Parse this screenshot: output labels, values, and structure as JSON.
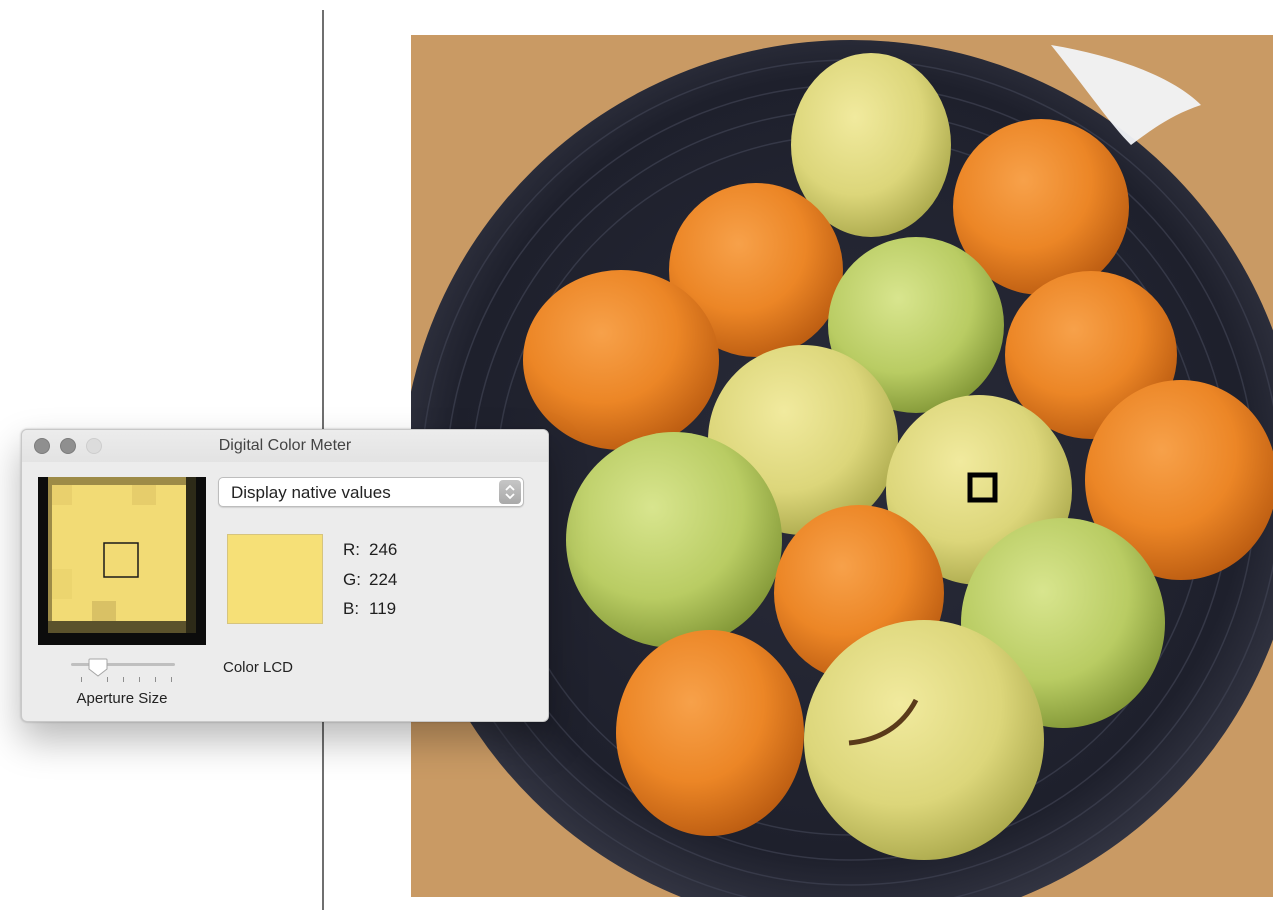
{
  "window": {
    "title": "Digital Color Meter"
  },
  "mode_select": {
    "value": "Display native values"
  },
  "color": {
    "r_label": "R:",
    "g_label": "G:",
    "b_label": "B:",
    "r": "246",
    "g": "224",
    "b": "119",
    "swatch_hex": "#f6e077"
  },
  "display_name": "Color LCD",
  "aperture": {
    "label": "Aperture Size",
    "level": 0.2
  },
  "photo": {
    "sample_marker_icon": "sample-square-marker"
  }
}
